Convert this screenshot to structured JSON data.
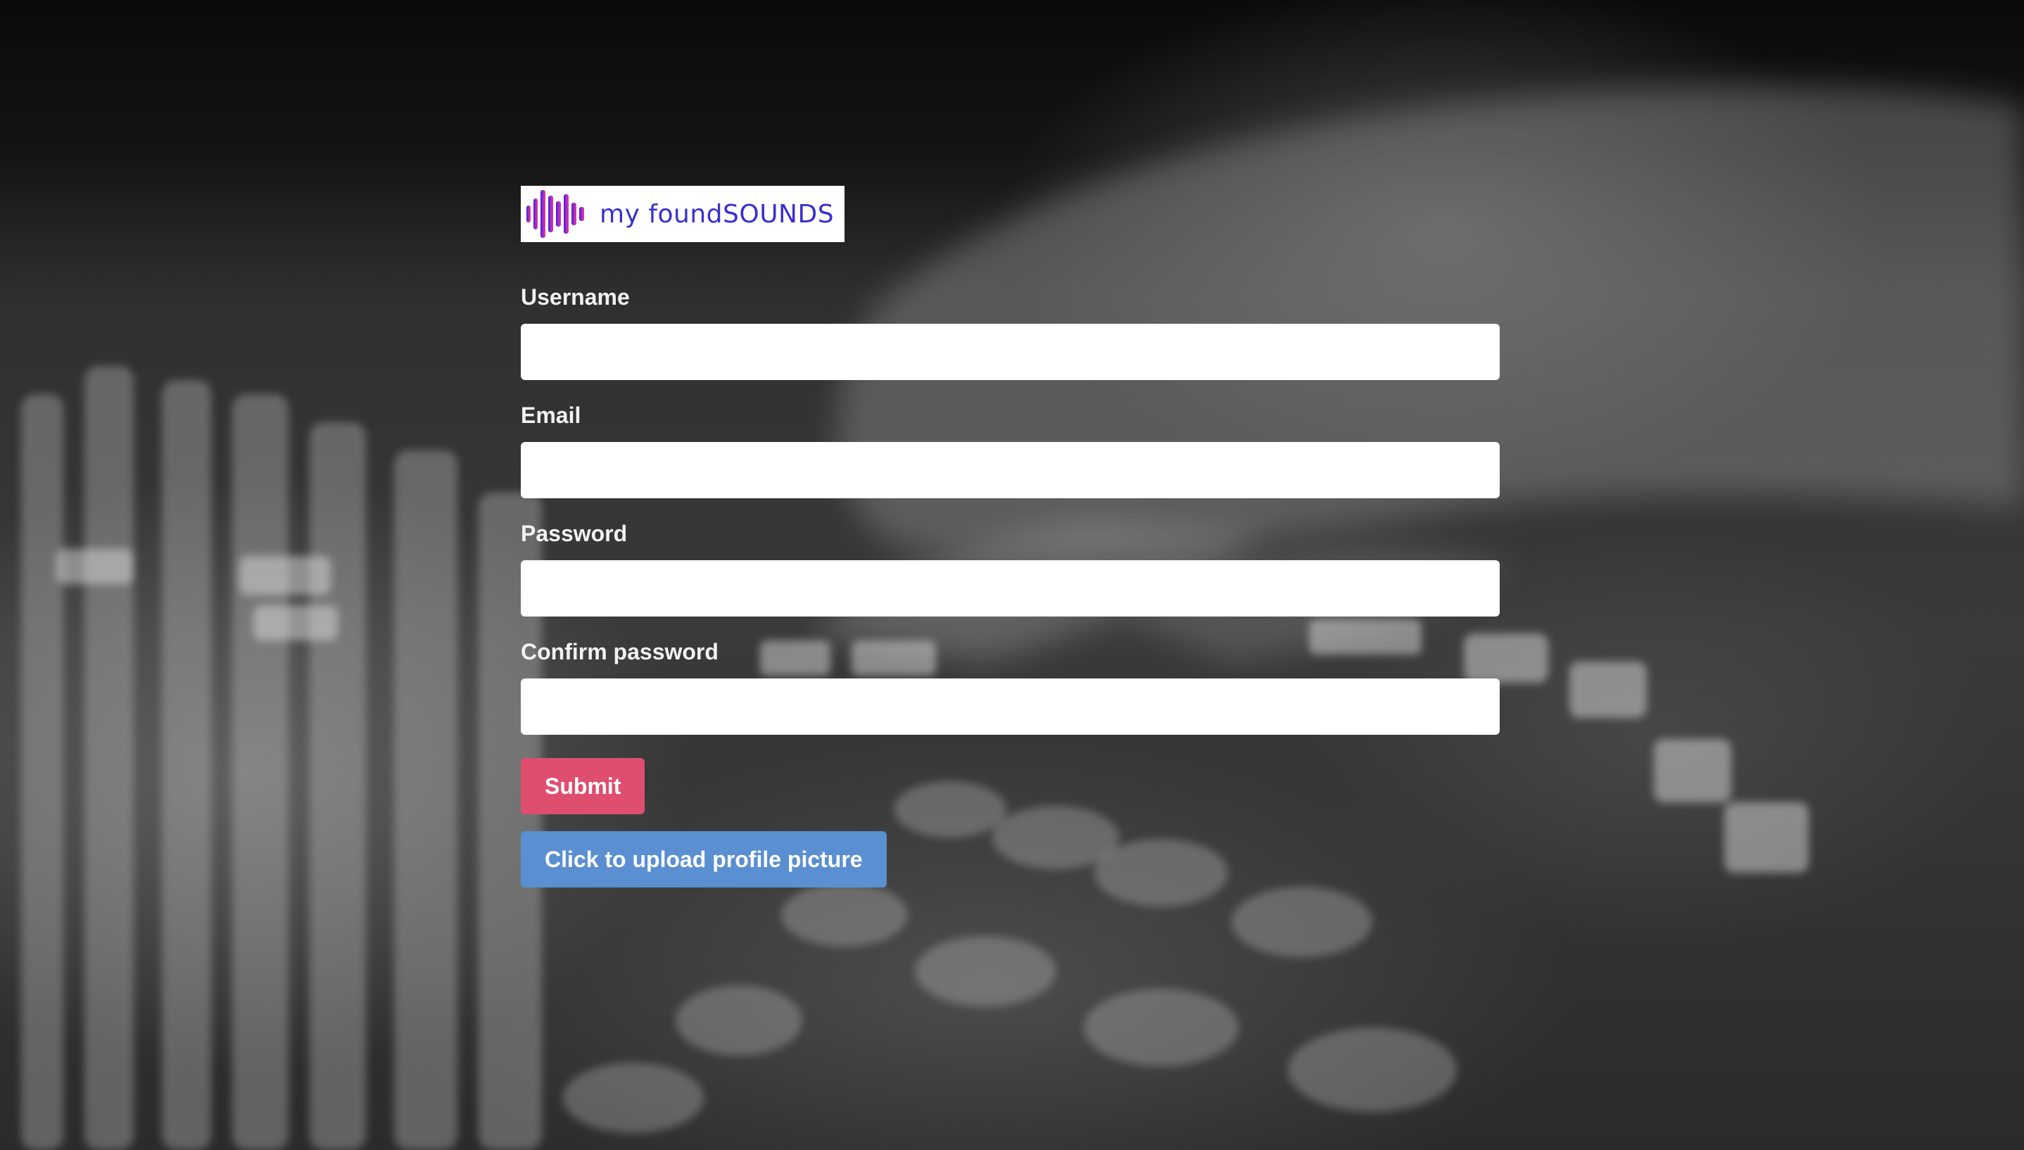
{
  "colors": {
    "logo_text": "#3a2fd0",
    "submit_button": "#df4e6e",
    "upload_button": "#5a8fd2",
    "label_text": "#f2f2f2",
    "input_background": "#ffffff"
  },
  "logo": {
    "icon": "soundwave-icon",
    "text": "my foundSOUNDS"
  },
  "form": {
    "fields": [
      {
        "label": "Username",
        "value": "",
        "placeholder": ""
      },
      {
        "label": "Email",
        "value": "",
        "placeholder": ""
      },
      {
        "label": "Password",
        "value": "",
        "placeholder": ""
      },
      {
        "label": "Confirm password",
        "value": "",
        "placeholder": ""
      }
    ],
    "submit_label": "Submit",
    "upload_label": "Click to upload profile picture"
  }
}
